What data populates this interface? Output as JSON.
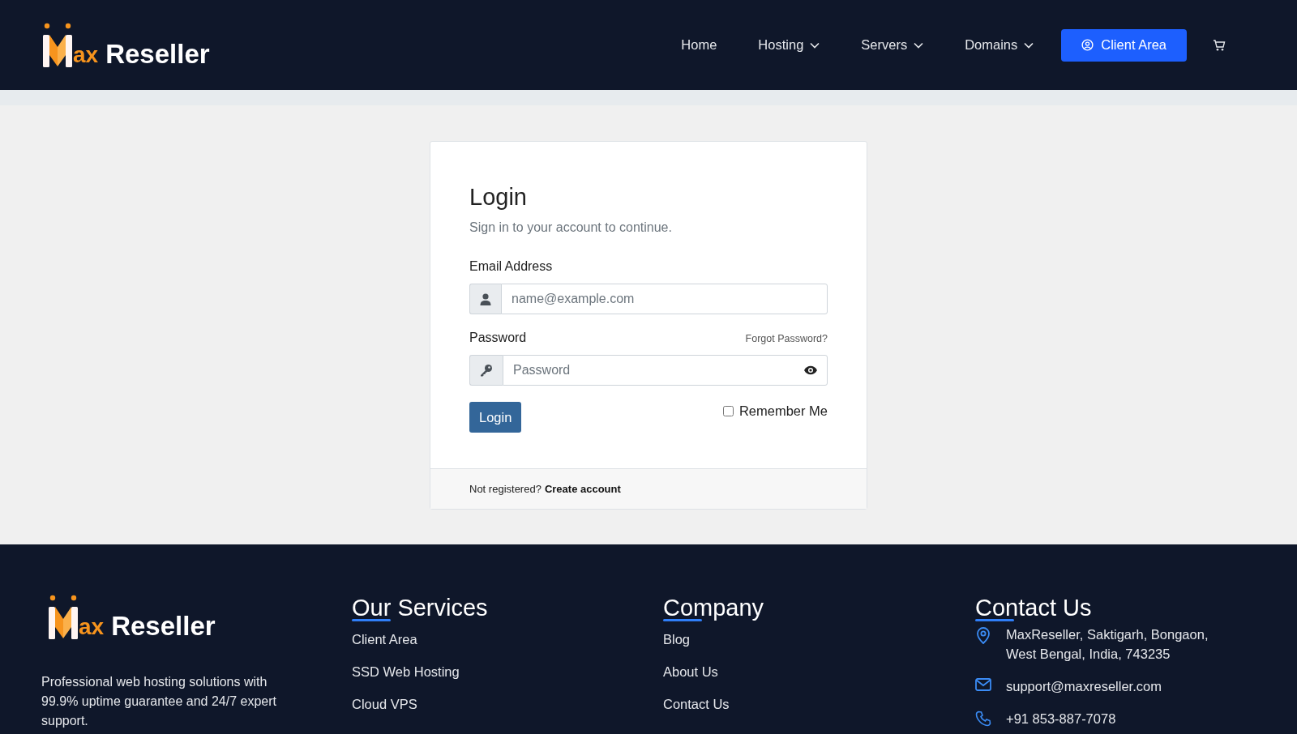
{
  "header": {
    "logo": {
      "accent": "ax",
      "name": "Reseller"
    },
    "nav": [
      {
        "label": "Home",
        "dropdown": false
      },
      {
        "label": "Hosting",
        "dropdown": true
      },
      {
        "label": "Servers",
        "dropdown": true
      },
      {
        "label": "Domains",
        "dropdown": true
      }
    ],
    "client_area": "Client Area"
  },
  "login": {
    "title": "Login",
    "subtitle": "Sign in to your account to continue.",
    "email": {
      "label": "Email Address",
      "placeholder": "name@example.com"
    },
    "password": {
      "label": "Password",
      "placeholder": "Password",
      "forgot": "Forgot Password?"
    },
    "button": "Login",
    "remember": {
      "label": "Remember Me",
      "checked": false
    },
    "footer": {
      "prompt": "Not registered?",
      "link": "Create account"
    }
  },
  "footer": {
    "logo": {
      "accent": "ax",
      "name": "Reseller"
    },
    "description": "Professional web hosting solutions with 99.9% uptime guarantee and 24/7 expert support.",
    "columns": [
      {
        "title": "Our Services",
        "links": [
          "Client Area",
          "SSD Web Hosting",
          "Cloud VPS"
        ]
      },
      {
        "title": "Company",
        "links": [
          "Blog",
          "About Us",
          "Contact Us"
        ]
      }
    ],
    "contact": {
      "title": "Contact Us",
      "items": [
        {
          "kind": "address",
          "text": "MaxReseller, Saktigarh, Bongaon, West Bengal, India, 743235"
        },
        {
          "kind": "email",
          "text": "support@maxreseller.com"
        },
        {
          "kind": "phone",
          "text": "+91 853-887-7078"
        }
      ]
    }
  }
}
